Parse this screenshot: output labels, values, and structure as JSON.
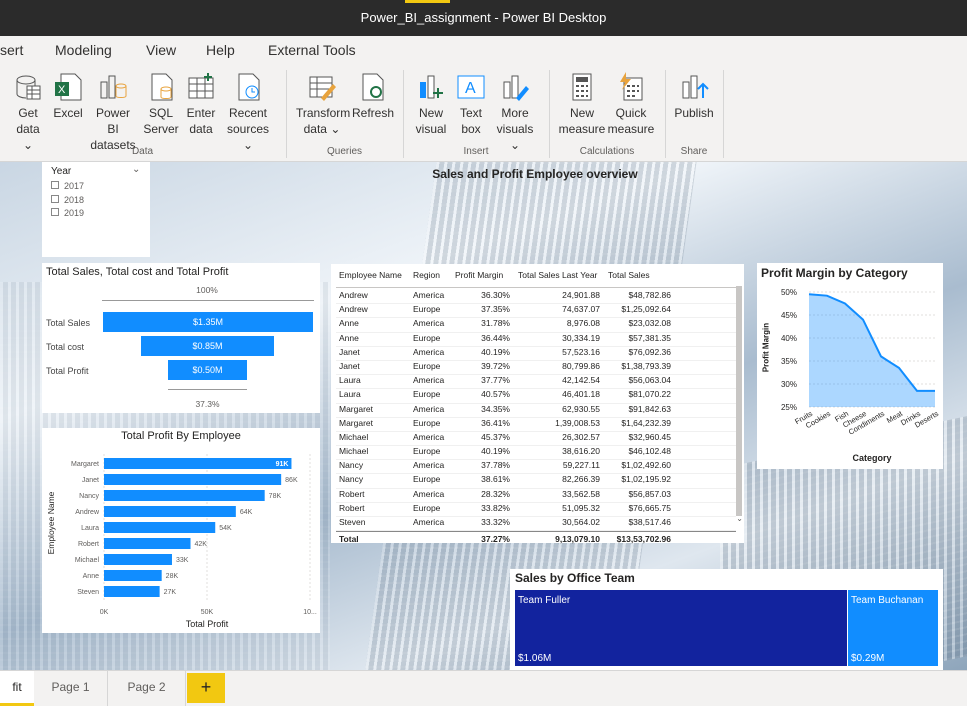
{
  "window": {
    "title": "Power_BI_assignment - Power BI Desktop"
  },
  "menu": [
    "sert",
    "Modeling",
    "View",
    "Help",
    "External Tools"
  ],
  "ribbon": {
    "data_group": "Data",
    "queries_group": "Queries",
    "insert_group": "Insert",
    "calc_group": "Calculations",
    "share_group": "Share",
    "get_data": [
      "Get",
      "data ⌄"
    ],
    "excel": [
      "Excel"
    ],
    "powerbi": [
      "Power BI",
      "datasets"
    ],
    "sql": [
      "SQL",
      "Server"
    ],
    "enter": [
      "Enter",
      "data"
    ],
    "recent": [
      "Recent",
      "sources ⌄"
    ],
    "transform": [
      "Transform",
      "data ⌄"
    ],
    "refresh": [
      "Refresh"
    ],
    "new_visual": [
      "New",
      "visual"
    ],
    "textbox": [
      "Text",
      "box"
    ],
    "more": [
      "More",
      "visuals ⌄"
    ],
    "new_measure": [
      "New",
      "measure"
    ],
    "quick": [
      "Quick",
      "measure"
    ],
    "publish": [
      "Publish"
    ]
  },
  "report": {
    "title": "Sales and Profit Employee overview"
  },
  "slicer": {
    "title": "Year",
    "items": [
      "2017",
      "2018",
      "2019"
    ]
  },
  "funnel": {
    "title": "Total Sales, Total cost and Total Profit",
    "top": "100%",
    "bottom": "37.3%",
    "rows": [
      {
        "label": "Total Sales",
        "value": "$1.35M"
      },
      {
        "label": "Total cost",
        "value": "$0.85M"
      },
      {
        "label": "Total Profit",
        "value": "$0.50M"
      }
    ]
  },
  "employee_chart": {
    "title": "Total Profit By Employee",
    "ylabel": "Employee Name",
    "xlabel": "Total Profit",
    "ticks": [
      "0K",
      "50K",
      "10..."
    ]
  },
  "table": {
    "headers": [
      "Employee Name",
      "Region",
      "Profit Margin",
      "Total Sales Last Year",
      "Total Sales"
    ],
    "rows": [
      [
        "Andrew",
        "America",
        "36.30%",
        "24,901.88",
        "$48,782.86"
      ],
      [
        "Andrew",
        "Europe",
        "37.35%",
        "74,637.07",
        "$1,25,092.64"
      ],
      [
        "Anne",
        "America",
        "31.78%",
        "8,976.08",
        "$23,032.08"
      ],
      [
        "Anne",
        "Europe",
        "36.44%",
        "30,334.19",
        "$57,381.35"
      ],
      [
        "Janet",
        "America",
        "40.19%",
        "57,523.16",
        "$76,092.36"
      ],
      [
        "Janet",
        "Europe",
        "39.72%",
        "80,799.86",
        "$1,38,793.39"
      ],
      [
        "Laura",
        "America",
        "37.77%",
        "42,142.54",
        "$56,063.04"
      ],
      [
        "Laura",
        "Europe",
        "40.57%",
        "46,401.18",
        "$81,070.22"
      ],
      [
        "Margaret",
        "America",
        "34.35%",
        "62,930.55",
        "$91,842.63"
      ],
      [
        "Margaret",
        "Europe",
        "36.41%",
        "1,39,008.53",
        "$1,64,232.39"
      ],
      [
        "Michael",
        "America",
        "45.37%",
        "26,302.57",
        "$32,960.45"
      ],
      [
        "Michael",
        "Europe",
        "40.19%",
        "38,616.20",
        "$46,102.48"
      ],
      [
        "Nancy",
        "America",
        "37.78%",
        "59,227.11",
        "$1,02,492.60"
      ],
      [
        "Nancy",
        "Europe",
        "38.61%",
        "82,266.39",
        "$1,02,195.92"
      ],
      [
        "Robert",
        "America",
        "28.32%",
        "33,562.58",
        "$56,857.03"
      ],
      [
        "Robert",
        "Europe",
        "33.82%",
        "51,095.32",
        "$76,665.75"
      ],
      [
        "Steven",
        "America",
        "33.32%",
        "30,564.02",
        "$38,517.46"
      ]
    ],
    "total": [
      "Total",
      "",
      "37.27%",
      "9,13,079.10",
      "$13,53,702.96"
    ]
  },
  "margin_chart": {
    "title": "Profit Margin by Category",
    "ylabel": "Profit Margin",
    "xlabel": "Category",
    "yticks": [
      "50%",
      "45%",
      "40%",
      "35%",
      "30%",
      "25%"
    ]
  },
  "office_chart": {
    "title": "Sales by Office Team",
    "teams": [
      {
        "name": "Team Fuller",
        "value": "$1.06M",
        "color": "#12239e"
      },
      {
        "name": "Team Buchanan",
        "value": "$0.29M",
        "color": "#118dff"
      }
    ]
  },
  "tabs": {
    "current": "fit",
    "pages": [
      "Page 1",
      "Page 2"
    ],
    "add": "+"
  },
  "chart_data": [
    {
      "type": "bar",
      "title": "Total Profit By Employee",
      "xlabel": "Total Profit",
      "ylabel": "Employee Name",
      "categories": [
        "Margaret",
        "Janet",
        "Nancy",
        "Andrew",
        "Laura",
        "Robert",
        "Michael",
        "Anne",
        "Steven"
      ],
      "values": [
        91,
        86,
        78,
        64,
        54,
        42,
        33,
        28,
        27
      ],
      "labels": [
        "91K",
        "86K",
        "78K",
        "64K",
        "54K",
        "42K",
        "33K",
        "28K",
        "27K"
      ],
      "xlim": [
        0,
        100
      ]
    },
    {
      "type": "area",
      "title": "Profit Margin by Category",
      "xlabel": "Category",
      "ylabel": "Profit Margin",
      "categories": [
        "Fruits",
        "Cookies",
        "Fish",
        "Cheese",
        "Condiments",
        "Meat",
        "Drinks",
        "Deserts"
      ],
      "values": [
        49.5,
        49.2,
        47.5,
        44,
        36,
        33.5,
        28.5,
        28.5
      ],
      "ylim": [
        25,
        50
      ]
    }
  ]
}
